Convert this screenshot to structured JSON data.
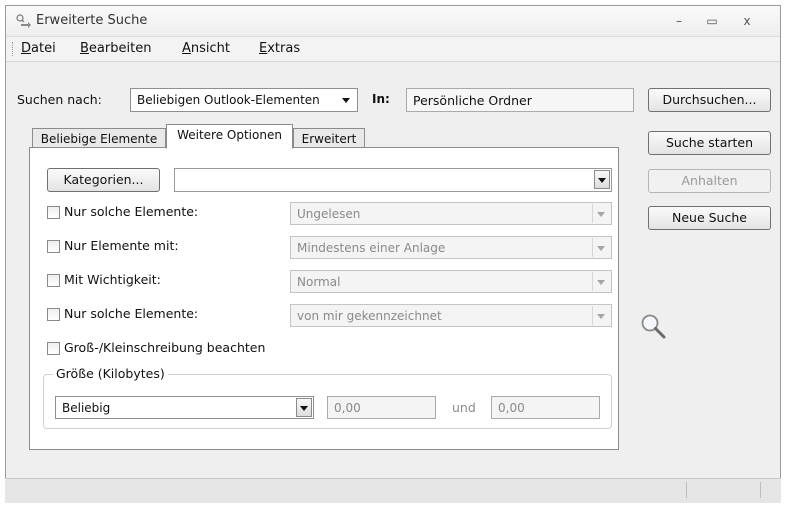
{
  "window": {
    "title": "Erweiterte Suche",
    "minimize": "–",
    "maximize": "▭",
    "close": "x"
  },
  "menu": [
    "Datei",
    "Bearbeiten",
    "Ansicht",
    "Extras"
  ],
  "search": {
    "label": "Suchen nach:",
    "type_value": "Beliebigen Outlook-Elementen",
    "in_label": "In:",
    "location_value": "Persönliche Ordner"
  },
  "buttons": {
    "browse": "Durchsuchen...",
    "start": "Suche starten",
    "stop": "Anhalten",
    "new": "Neue Suche"
  },
  "tabs": [
    "Beliebige Elemente",
    "Weitere Optionen",
    "Erweitert"
  ],
  "active_tab": "Weitere Optionen",
  "options": {
    "categories_button": "Kategorien...",
    "categories_value": "",
    "rows": [
      {
        "label": "Nur solche Elemente:",
        "value": "Ungelesen",
        "checked": false
      },
      {
        "label": "Nur Elemente mit:",
        "value": "Mindestens einer Anlage",
        "checked": false
      },
      {
        "label": "Mit Wichtigkeit:",
        "value": "Normal",
        "checked": false
      },
      {
        "label": "Nur solche Elemente:",
        "value": "von mir gekennzeichnet",
        "checked": false
      }
    ],
    "match_case": {
      "label": "Groß-/Kleinschreibung beachten",
      "checked": false
    }
  },
  "size": {
    "group_title": "Größe (Kilobytes)",
    "mode_value": "Beliebig",
    "from_value": "0,00",
    "and_label": "und",
    "to_value": "0,00"
  },
  "icons": {
    "search": "magnifier-icon",
    "app": "advanced-find-icon"
  }
}
